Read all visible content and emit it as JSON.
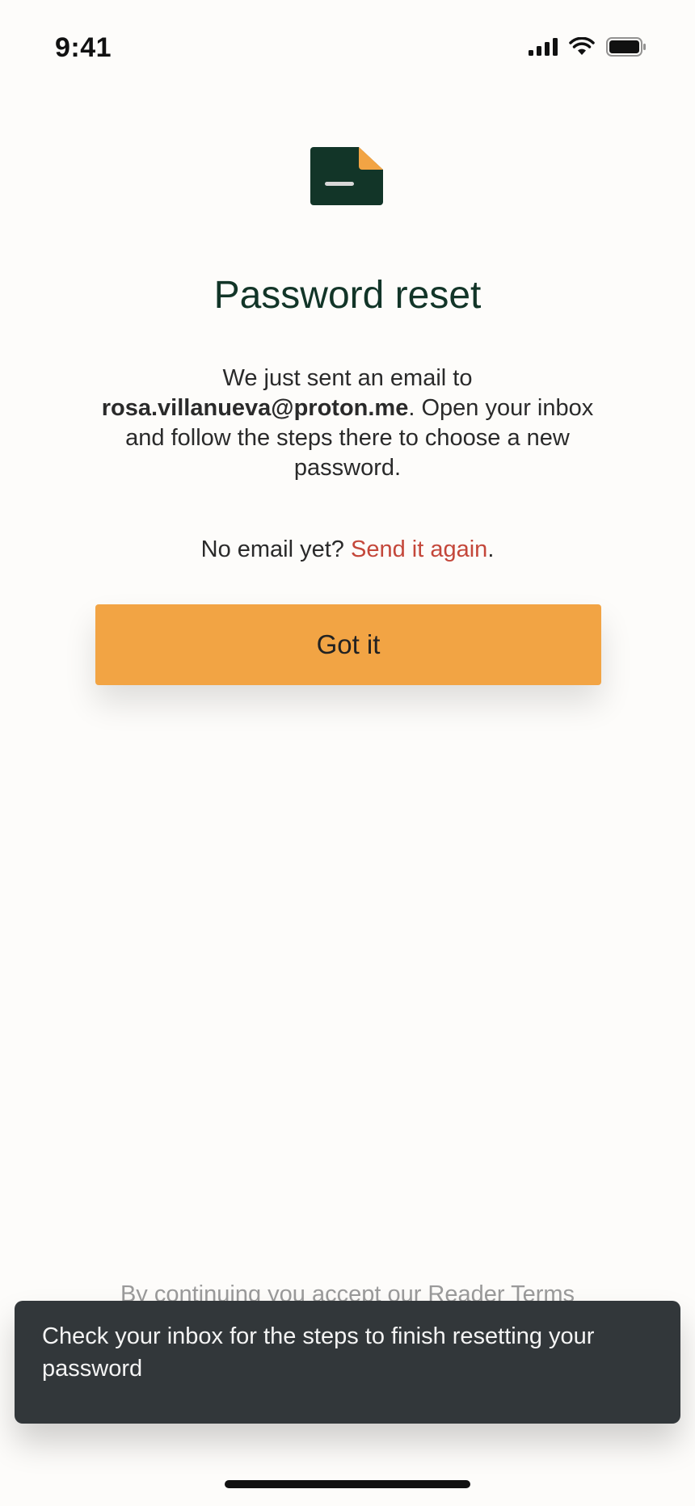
{
  "status_bar": {
    "time": "9:41",
    "icons": [
      "signal-icon",
      "wifi-icon",
      "battery-icon"
    ]
  },
  "logo": {
    "icon": "document-logo-icon",
    "colors": {
      "body": "#123528",
      "fold": "#f2a444",
      "line": "#d8d8d8"
    }
  },
  "header": {
    "title": "Password reset"
  },
  "message": {
    "prefix": "We just sent an email to",
    "email": "rosa.villanueva@proton.me",
    "suffix": ". Open your inbox and follow the steps there to choose a new password."
  },
  "resend": {
    "prompt": "No email yet?",
    "link_label": "Send it again",
    "trailing": "."
  },
  "actions": {
    "got_it_label": "Got it"
  },
  "footer": {
    "terms_text": "By continuing you accept our Reader Terms"
  },
  "toast": {
    "message": "Check your inbox for the steps to finish resetting your password"
  },
  "colors": {
    "background": "#fdfcfa",
    "title": "#123528",
    "accent": "#f2a444",
    "link": "#c4473a",
    "toast_bg": "#32373a"
  }
}
